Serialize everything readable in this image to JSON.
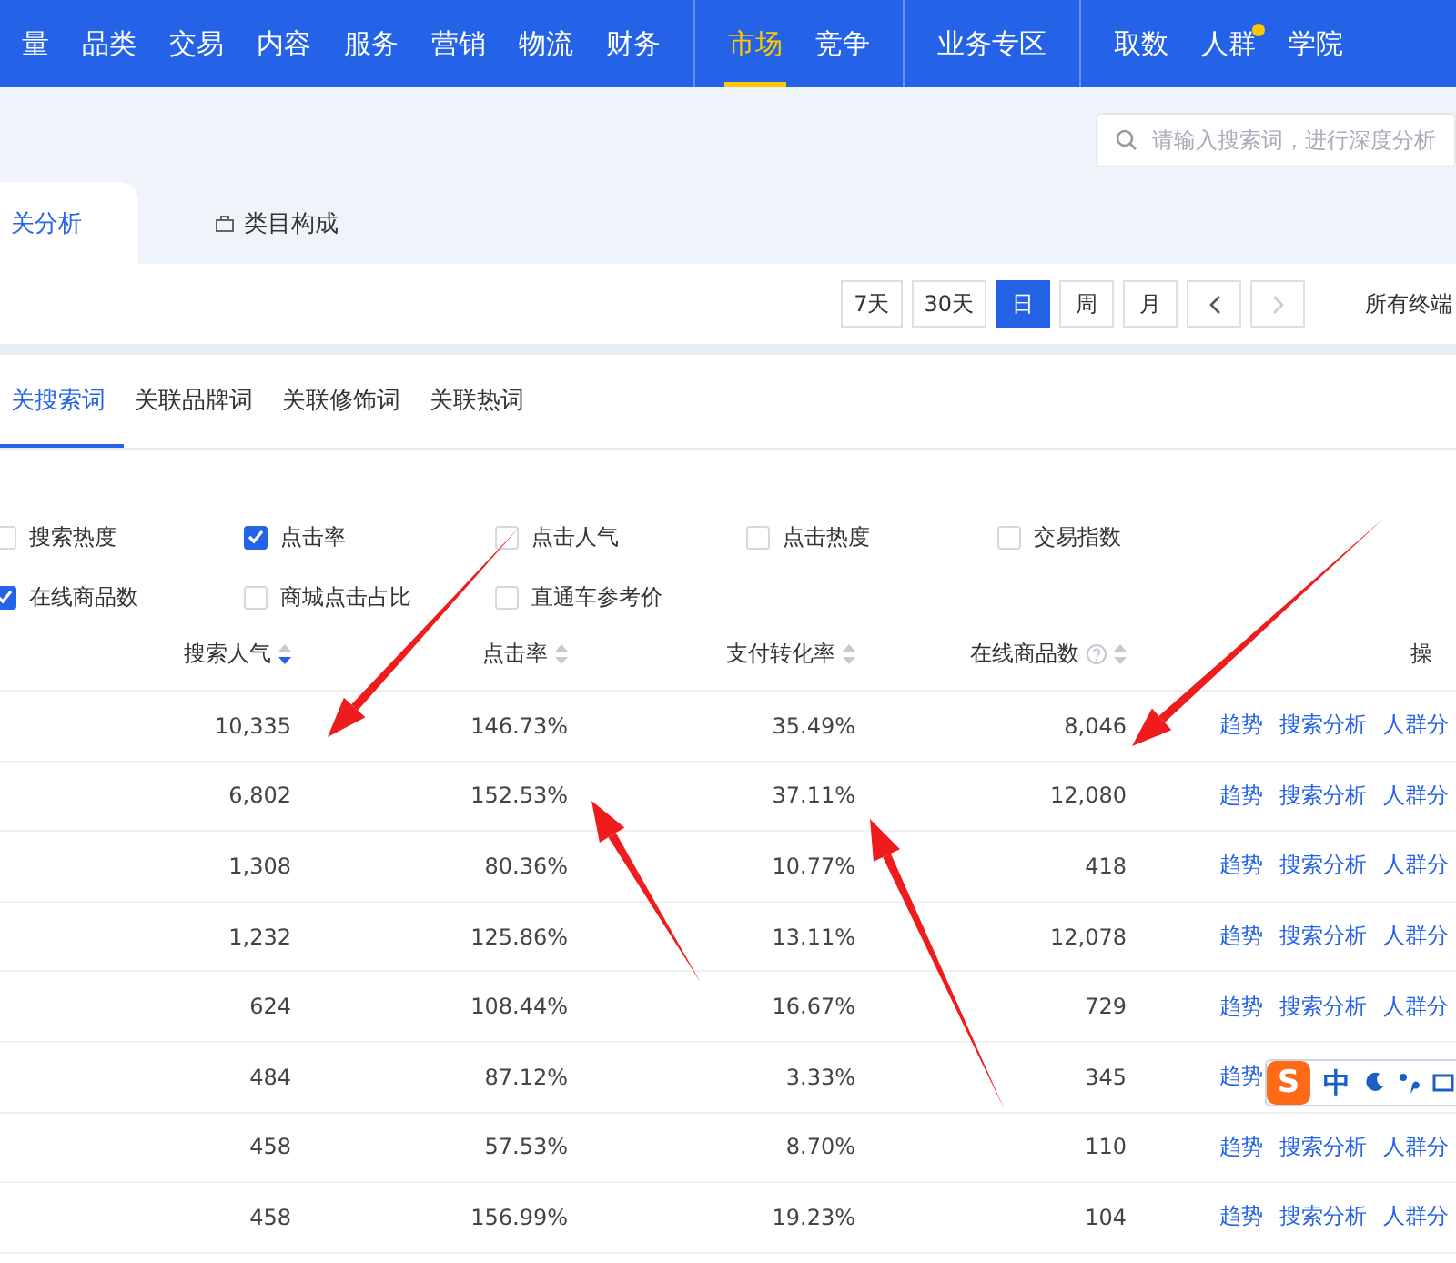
{
  "nav": {
    "groups": [
      [
        {
          "label": "量",
          "selected": false,
          "dot": false
        },
        {
          "label": "品类",
          "selected": false,
          "dot": false
        },
        {
          "label": "交易",
          "selected": false,
          "dot": false
        },
        {
          "label": "内容",
          "selected": false,
          "dot": false
        },
        {
          "label": "服务",
          "selected": false,
          "dot": false
        },
        {
          "label": "营销",
          "selected": false,
          "dot": false
        },
        {
          "label": "物流",
          "selected": false,
          "dot": false
        },
        {
          "label": "财务",
          "selected": false,
          "dot": false
        }
      ],
      [
        {
          "label": "市场",
          "selected": true,
          "dot": false
        },
        {
          "label": "竞争",
          "selected": false,
          "dot": false
        }
      ],
      [
        {
          "label": "业务专区",
          "selected": false,
          "dot": false
        }
      ],
      [
        {
          "label": "取数",
          "selected": false,
          "dot": false
        },
        {
          "label": "人群",
          "selected": false,
          "dot": true
        },
        {
          "label": "学院",
          "selected": false,
          "dot": false
        }
      ]
    ]
  },
  "search": {
    "placeholder": "请输入搜索词，进行深度分析"
  },
  "page_tabs": [
    {
      "label": "关分析",
      "selected": true
    },
    {
      "label": "类目构成",
      "selected": false
    }
  ],
  "date_buttons": [
    {
      "label": "7天",
      "selected": false
    },
    {
      "label": "30天",
      "selected": false
    },
    {
      "label": "日",
      "selected": true
    },
    {
      "label": "周",
      "selected": false
    },
    {
      "label": "月",
      "selected": false
    }
  ],
  "pager": {
    "prev_disabled": false,
    "next_disabled": true
  },
  "terminal": "所有终端",
  "sub_tabs": [
    {
      "label": "关搜索词",
      "selected": true
    },
    {
      "label": "关联品牌词",
      "selected": false
    },
    {
      "label": "关联修饰词",
      "selected": false
    },
    {
      "label": "关联热词",
      "selected": false
    }
  ],
  "metrics": [
    {
      "label": "搜索热度",
      "checked": false
    },
    {
      "label": "点击率",
      "checked": true
    },
    {
      "label": "点击人气",
      "checked": false
    },
    {
      "label": "点击热度",
      "checked": false
    },
    {
      "label": "交易指数",
      "checked": false
    },
    {
      "label": "在线商品数",
      "checked": true
    },
    {
      "label": "商城点击占比",
      "checked": false
    },
    {
      "label": "直通车参考价",
      "checked": false
    }
  ],
  "table": {
    "columns": [
      {
        "label": "搜索人气",
        "sort_active": true,
        "help": false
      },
      {
        "label": "点击率",
        "sort_active": false,
        "help": false
      },
      {
        "label": "支付转化率",
        "sort_active": false,
        "help": false
      },
      {
        "label": "在线商品数",
        "sort_active": false,
        "help": true
      },
      {
        "label": "操",
        "help": false
      }
    ],
    "rows": [
      {
        "cells": [
          "10,335",
          "146.73%",
          "35.49%",
          "8,046"
        ],
        "actions": [
          "趋势",
          "搜索分析",
          "人群分"
        ]
      },
      {
        "cells": [
          "6,802",
          "152.53%",
          "37.11%",
          "12,080"
        ],
        "actions": [
          "趋势",
          "搜索分析",
          "人群分"
        ]
      },
      {
        "cells": [
          "1,308",
          "80.36%",
          "10.77%",
          "418"
        ],
        "actions": [
          "趋势",
          "搜索分析",
          "人群分"
        ]
      },
      {
        "cells": [
          "1,232",
          "125.86%",
          "13.11%",
          "12,078"
        ],
        "actions": [
          "趋势",
          "搜索分析",
          "人群分"
        ]
      },
      {
        "cells": [
          "624",
          "108.44%",
          "16.67%",
          "729"
        ],
        "actions": [
          "趋势",
          "搜索分析",
          "人群分"
        ]
      },
      {
        "cells": [
          "484",
          "87.12%",
          "3.33%",
          "345"
        ],
        "actions": [
          "趋势"
        ]
      },
      {
        "cells": [
          "458",
          "57.53%",
          "8.70%",
          "110"
        ],
        "actions": [
          "趋势",
          "搜索分析",
          "人群分"
        ]
      },
      {
        "cells": [
          "458",
          "156.99%",
          "19.23%",
          "104"
        ],
        "actions": [
          "趋势",
          "搜索分析",
          "人群分"
        ]
      }
    ]
  },
  "ime_bar": {
    "logo": "S",
    "mode": "中"
  }
}
